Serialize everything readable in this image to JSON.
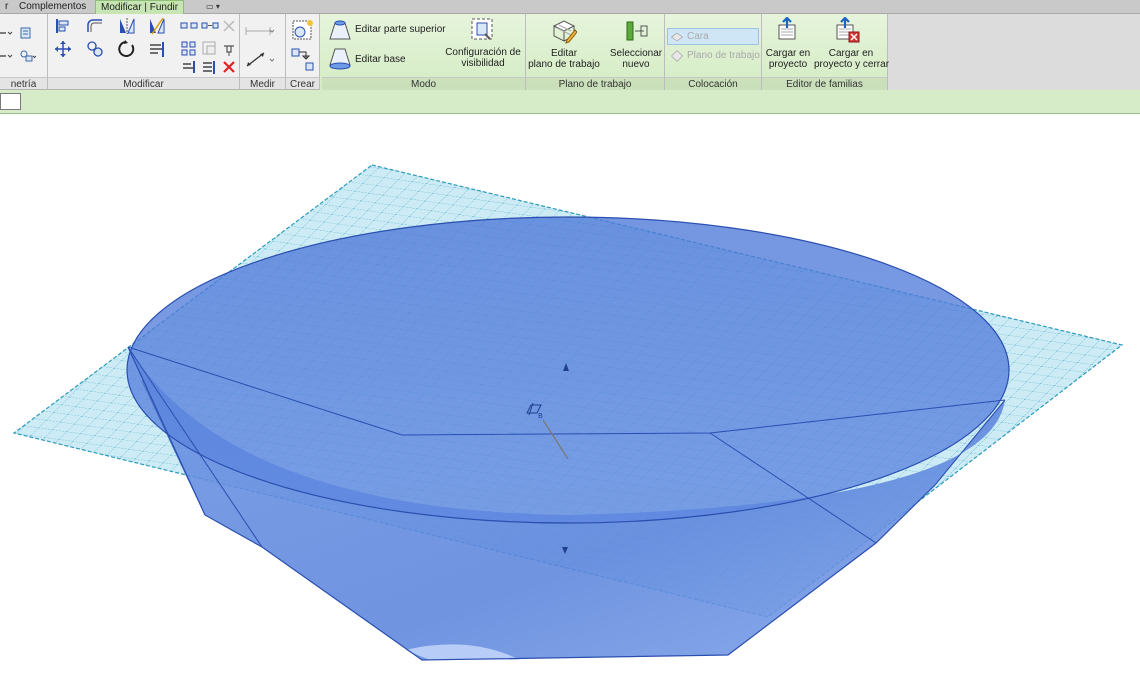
{
  "tabs": [
    {
      "label": "r",
      "active": false
    },
    {
      "label": "Complementos",
      "active": false
    },
    {
      "label": "Modificar | Fundir",
      "active": true
    }
  ],
  "tab_pin_glyph": "▭ ▾",
  "ribbon": {
    "panels": {
      "geometria": "netría",
      "modificar": "Modificar",
      "medir": "Medir",
      "crear": "Crear",
      "modo": "Modo",
      "plano_trabajo": "Plano de trabajo",
      "colocacion": "Colocación",
      "editor_familias": "Editor de familias"
    },
    "modo": {
      "editar_superior": "Editar parte superior",
      "editar_base": "Editar base",
      "config_visibilidad_1": "Configuración de",
      "config_visibilidad_2": "visibilidad"
    },
    "plano": {
      "editar_plano_1": "Editar",
      "editar_plano_2": "plano de trabajo",
      "seleccionar_1": "Seleccionar",
      "seleccionar_2": "nuevo"
    },
    "colocacion": {
      "cara": "Cara",
      "plano_trabajo": "Plano de trabajo"
    },
    "familias": {
      "cargar_1": "Cargar en",
      "cargar_2": "proyecto",
      "cargar_cerrar_1": "Cargar en",
      "cargar_cerrar_2": "proyecto y cerrar"
    }
  },
  "colors": {
    "ribbon_green": "#d4ecc4",
    "solid_fill": "#5b86df",
    "grid_plane": "#bfe6f2",
    "grid_line": "#2b9bbb",
    "edge": "#2a4fb0"
  }
}
